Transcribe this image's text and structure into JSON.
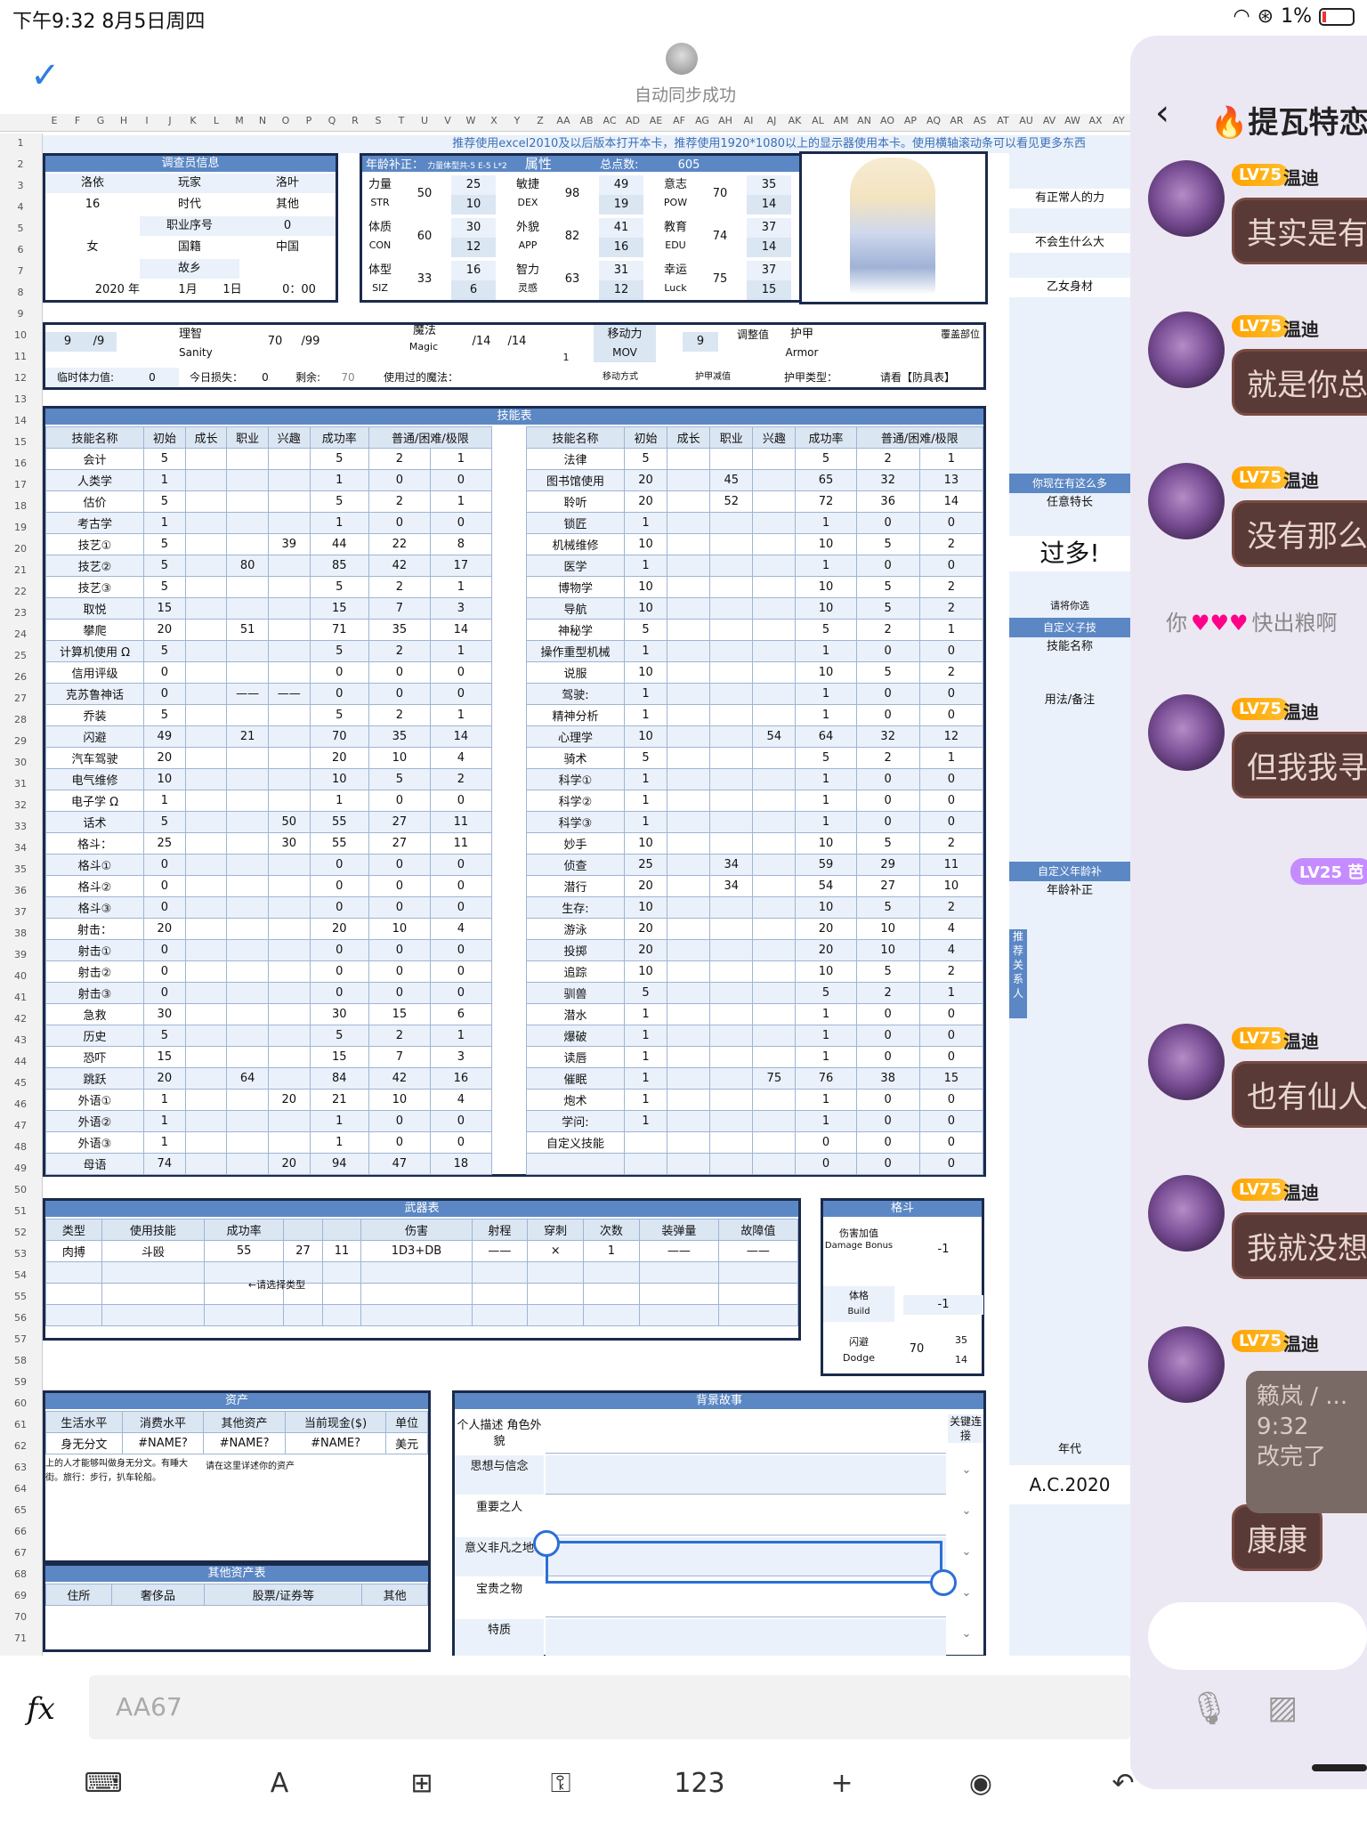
{
  "status": {
    "time": "下午9:32  8月5日周四",
    "battery": "1%"
  },
  "top": {
    "sync": "自动同步成功"
  },
  "column_letters": [
    "E",
    "F",
    "G",
    "H",
    "I",
    "J",
    "K",
    "L",
    "M",
    "N",
    "O",
    "P",
    "Q",
    "R",
    "S",
    "T",
    "U",
    "V",
    "W",
    "X",
    "Y",
    "Z",
    "AA",
    "AB",
    "AC",
    "AD",
    "AE",
    "AF",
    "AG",
    "AH",
    "AI",
    "AJ",
    "AK",
    "AL",
    "AM",
    "AN",
    "AO",
    "AP",
    "AQ",
    "AR",
    "AS",
    "AT",
    "AU",
    "AV",
    "AW",
    "AX",
    "AY"
  ],
  "sheet": {
    "banner": "推荐使用excel2010及以后版本打开本卡，推荐使用1920*1080以上的显示器使用本卡。使用横轴滚动条可以看见更多东西",
    "investigator": {
      "title": "调查员信息",
      "name": "洛依",
      "player_label": "玩家",
      "player": "洛叶",
      "age": "16",
      "era_label": "时代",
      "era": "其他",
      "job_label": "职业序号",
      "job": "0",
      "sex": "女",
      "nation_label": "国籍",
      "nation": "中国",
      "home_label": "故乡",
      "year": "2020 年",
      "month": "1月",
      "day": "1日",
      "clock": "0：00"
    },
    "attr": {
      "age_label": "年龄补正：",
      "age_hint": "力量体型共-5 E-5 L*2",
      "title": "属性",
      "total_label": "总点数:",
      "total": "605",
      "str_cn": "力量",
      "str": "STR",
      "str_v": "50",
      "str_a": "25",
      "str_b": "10",
      "dex_cn": "敏捷",
      "dex": "DEX",
      "dex_v": "98",
      "dex_a": "49",
      "dex_b": "19",
      "pow_cn": "意志",
      "pow": "POW",
      "pow_v": "70",
      "pow_a": "35",
      "pow_b": "14",
      "con_cn": "体质",
      "con": "CON",
      "con_v": "60",
      "con_a": "30",
      "con_b": "12",
      "app_cn": "外貌",
      "app": "APP",
      "app_v": "82",
      "app_a": "41",
      "app_b": "16",
      "edu_cn": "教育",
      "edu": "EDU",
      "edu_v": "74",
      "edu_a": "37",
      "edu_b": "14",
      "siz_cn": "体型",
      "siz": "SIZ",
      "siz_v": "33",
      "siz_a": "16",
      "siz_b": "6",
      "int_cn": "智力",
      "int": "灵感",
      "int_v": "63",
      "int_a": "31",
      "int_b": "12",
      "luck_cn": "幸运",
      "luck": "Luck",
      "luck_v": "75",
      "luck_a": "37",
      "luck_b": "15"
    },
    "status_row": {
      "hp": "9",
      "hp_max": "/9",
      "san_cn": "理智",
      "san": "Sanity",
      "san_v": "70",
      "san_max": "/99",
      "magic_cn": "魔法",
      "magic": "Magic",
      "mp": "/14",
      "mp_max": "/14",
      "mp_regen": "1",
      "move_cn": "移动力",
      "move": "MOV",
      "move_v": "9",
      "adjust": "调整值",
      "armor_cn": "护甲",
      "armor": "Armor",
      "cover": "覆盖部位",
      "temp_hp": "临时体力值:",
      "temp_hp_v": "0",
      "loss": "今日损失：",
      "loss_v": "0",
      "remain": "剩余:",
      "remain_v": "70",
      "spells": "使用过的魔法：",
      "move_mode": "移动方式",
      "armor_red": "护甲减值",
      "armor_type": "护甲类型：",
      "armor_note": "请看【防具表】"
    },
    "skills_title": "技能表",
    "skill_headers": [
      "技能名称",
      "初始",
      "成长",
      "职业",
      "兴趣",
      "成功率",
      "普通/困难/极限"
    ],
    "skills_left": [
      [
        "会计",
        "5",
        "",
        "",
        "",
        "5",
        "2",
        "1"
      ],
      [
        "人类学",
        "1",
        "",
        "",
        "",
        "1",
        "0",
        "0"
      ],
      [
        "估价",
        "5",
        "",
        "",
        "",
        "5",
        "2",
        "1"
      ],
      [
        "考古学",
        "1",
        "",
        "",
        "",
        "1",
        "0",
        "0"
      ],
      [
        "技艺①",
        "5",
        "",
        "",
        "39",
        "44",
        "22",
        "8"
      ],
      [
        "技艺②",
        "5",
        "",
        "80",
        "",
        "85",
        "42",
        "17"
      ],
      [
        "技艺③",
        "5",
        "",
        "",
        "",
        "5",
        "2",
        "1"
      ],
      [
        "取悦",
        "15",
        "",
        "",
        "",
        "15",
        "7",
        "3"
      ],
      [
        "攀爬",
        "20",
        "",
        "51",
        "",
        "71",
        "35",
        "14"
      ],
      [
        "计算机使用 Ω",
        "5",
        "",
        "",
        "",
        "5",
        "2",
        "1"
      ],
      [
        "信用评级",
        "0",
        "",
        "",
        "",
        "0",
        "0",
        "0"
      ],
      [
        "克苏鲁神话",
        "0",
        "",
        "——",
        "——",
        "0",
        "0",
        "0"
      ],
      [
        "乔装",
        "5",
        "",
        "",
        "",
        "5",
        "2",
        "1"
      ],
      [
        "闪避",
        "49",
        "",
        "21",
        "",
        "70",
        "35",
        "14"
      ],
      [
        "汽车驾驶",
        "20",
        "",
        "",
        "",
        "20",
        "10",
        "4"
      ],
      [
        "电气维修",
        "10",
        "",
        "",
        "",
        "10",
        "5",
        "2"
      ],
      [
        "电子学 Ω",
        "1",
        "",
        "",
        "",
        "1",
        "0",
        "0"
      ],
      [
        "话术",
        "5",
        "",
        "",
        "50",
        "55",
        "27",
        "11"
      ],
      [
        "格斗：",
        "25",
        "",
        "",
        "30",
        "55",
        "27",
        "11"
      ],
      [
        "格斗①",
        "0",
        "",
        "",
        "",
        "0",
        "0",
        "0"
      ],
      [
        "格斗②",
        "0",
        "",
        "",
        "",
        "0",
        "0",
        "0"
      ],
      [
        "格斗③",
        "0",
        "",
        "",
        "",
        "0",
        "0",
        "0"
      ],
      [
        "射击：",
        "20",
        "",
        "",
        "",
        "20",
        "10",
        "4"
      ],
      [
        "射击①",
        "0",
        "",
        "",
        "",
        "0",
        "0",
        "0"
      ],
      [
        "射击②",
        "0",
        "",
        "",
        "",
        "0",
        "0",
        "0"
      ],
      [
        "射击③",
        "0",
        "",
        "",
        "",
        "0",
        "0",
        "0"
      ],
      [
        "急救",
        "30",
        "",
        "",
        "",
        "30",
        "15",
        "6"
      ],
      [
        "历史",
        "5",
        "",
        "",
        "",
        "5",
        "2",
        "1"
      ],
      [
        "恐吓",
        "15",
        "",
        "",
        "",
        "15",
        "7",
        "3"
      ],
      [
        "跳跃",
        "20",
        "",
        "64",
        "",
        "84",
        "42",
        "16"
      ],
      [
        "外语①",
        "1",
        "",
        "",
        "20",
        "21",
        "10",
        "4"
      ],
      [
        "外语②",
        "1",
        "",
        "",
        "",
        "1",
        "0",
        "0"
      ],
      [
        "外语③",
        "1",
        "",
        "",
        "",
        "1",
        "0",
        "0"
      ],
      [
        "母语",
        "74",
        "",
        "",
        "20",
        "94",
        "47",
        "18"
      ]
    ],
    "skills_right": [
      [
        "法律",
        "5",
        "",
        "",
        "",
        "5",
        "2",
        "1"
      ],
      [
        "图书馆使用",
        "20",
        "",
        "45",
        "",
        "65",
        "32",
        "13"
      ],
      [
        "聆听",
        "20",
        "",
        "52",
        "",
        "72",
        "36",
        "14"
      ],
      [
        "锁匠",
        "1",
        "",
        "",
        "",
        "1",
        "0",
        "0"
      ],
      [
        "机械维修",
        "10",
        "",
        "",
        "",
        "10",
        "5",
        "2"
      ],
      [
        "医学",
        "1",
        "",
        "",
        "",
        "1",
        "0",
        "0"
      ],
      [
        "博物学",
        "10",
        "",
        "",
        "",
        "10",
        "5",
        "2"
      ],
      [
        "导航",
        "10",
        "",
        "",
        "",
        "10",
        "5",
        "2"
      ],
      [
        "神秘学",
        "5",
        "",
        "",
        "",
        "5",
        "2",
        "1"
      ],
      [
        "操作重型机械",
        "1",
        "",
        "",
        "",
        "1",
        "0",
        "0"
      ],
      [
        "说服",
        "10",
        "",
        "",
        "",
        "10",
        "5",
        "2"
      ],
      [
        "驾驶:",
        "1",
        "",
        "",
        "",
        "1",
        "0",
        "0"
      ],
      [
        "精神分析",
        "1",
        "",
        "",
        "",
        "1",
        "0",
        "0"
      ],
      [
        "心理学",
        "10",
        "",
        "",
        "54",
        "64",
        "32",
        "12"
      ],
      [
        "骑术",
        "5",
        "",
        "",
        "",
        "5",
        "2",
        "1"
      ],
      [
        "科学①",
        "1",
        "",
        "",
        "",
        "1",
        "0",
        "0"
      ],
      [
        "科学②",
        "1",
        "",
        "",
        "",
        "1",
        "0",
        "0"
      ],
      [
        "科学③",
        "1",
        "",
        "",
        "",
        "1",
        "0",
        "0"
      ],
      [
        "妙手",
        "10",
        "",
        "",
        "",
        "10",
        "5",
        "2"
      ],
      [
        "侦查",
        "25",
        "",
        "34",
        "",
        "59",
        "29",
        "11"
      ],
      [
        "潜行",
        "20",
        "",
        "34",
        "",
        "54",
        "27",
        "10"
      ],
      [
        "生存:",
        "10",
        "",
        "",
        "",
        "10",
        "5",
        "2"
      ],
      [
        "游泳",
        "20",
        "",
        "",
        "",
        "20",
        "10",
        "4"
      ],
      [
        "投掷",
        "20",
        "",
        "",
        "",
        "20",
        "10",
        "4"
      ],
      [
        "追踪",
        "10",
        "",
        "",
        "",
        "10",
        "5",
        "2"
      ],
      [
        "驯兽",
        "5",
        "",
        "",
        "",
        "5",
        "2",
        "1"
      ],
      [
        "潜水",
        "1",
        "",
        "",
        "",
        "1",
        "0",
        "0"
      ],
      [
        "爆破",
        "1",
        "",
        "",
        "",
        "1",
        "0",
        "0"
      ],
      [
        "读唇",
        "1",
        "",
        "",
        "",
        "1",
        "0",
        "0"
      ],
      [
        "催眠",
        "1",
        "",
        "",
        "75",
        "76",
        "38",
        "15"
      ],
      [
        "炮术",
        "1",
        "",
        "",
        "",
        "1",
        "0",
        "0"
      ],
      [
        "学问:",
        "1",
        "",
        "",
        "",
        "1",
        "0",
        "0"
      ],
      [
        "自定义技能",
        "",
        "",
        "",
        "",
        "0",
        "0",
        "0"
      ],
      [
        "",
        "",
        "",
        "",
        "",
        "0",
        "0",
        "0"
      ]
    ],
    "weapons": {
      "title": "武器表",
      "headers": [
        "类型",
        "使用技能",
        "成功率",
        "",
        "",
        "伤害",
        "射程",
        "穿刺",
        "次数",
        "装弹量",
        "故障值"
      ],
      "row": [
        "肉搏",
        "斗殴",
        "55",
        "27",
        "11",
        "1D3+DB",
        "——",
        "×",
        "1",
        "——",
        "——"
      ],
      "hint": "←请选择类型"
    },
    "combat": {
      "title": "格斗",
      "db_cn": "伤害加值",
      "db": "Damage Bonus",
      "db_v": "-1",
      "build_cn": "体格",
      "build": "Build",
      "build_v": "-1",
      "dodge_cn": "闪避",
      "dodge": "Dodge",
      "dodge_v": "70",
      "dodge_a": "35",
      "dodge_b": "14"
    },
    "assets": {
      "title": "资产",
      "headers": [
        "生活水平",
        "消费水平",
        "其他资产",
        "当前现金($)",
        "单位"
      ],
      "row": [
        "身无分文",
        "#NAME?",
        "#NAME?",
        "#NAME?",
        "美元"
      ],
      "note": "上的人才能够叫做身无分文。有睡大街。旅行：步行，扒车轮船。",
      "hint": "请在这里详述你的资产"
    },
    "other_assets": {
      "title": "其他资产表",
      "headers": [
        "住所",
        "奢侈品",
        "股票/证券等",
        "其他"
      ]
    },
    "story": {
      "title": "背景故事",
      "link": "关键连接",
      "items": [
        "个人描述 角色外貌",
        "思想与信念",
        "重要之人",
        "意义非凡之地",
        "宝贵之物",
        "特质"
      ]
    },
    "right_panel": {
      "a": "有正常人的力",
      "b": "不会生什么大",
      "c": "乙女身材",
      "d": "你现在有这么多",
      "e": "任意特长",
      "f": "过多!",
      "g": "请将你选",
      "h": "自定义子技",
      "i": "技能名称",
      "j": "用法/备注",
      "k": "自定义年龄补",
      "l": "年龄补正",
      "m": "推荐关系人",
      "n": "年代",
      "o": "A.C.2020"
    }
  },
  "formula_bar": {
    "fx": "fx",
    "cell": "AA67"
  },
  "toolbar": {
    "items": [
      "⌨",
      "A",
      "⊞",
      "⚿",
      "123",
      "+",
      "◉",
      "↶"
    ]
  },
  "chat": {
    "title": "提瓦特恋",
    "messages": [
      {
        "lv": "LV75",
        "name": "温迪",
        "text": "其实是有"
      },
      {
        "lv": "LV75",
        "name": "温迪",
        "text": "就是你总"
      },
      {
        "lv": "LV75",
        "name": "温迪",
        "text": "没有那么"
      },
      {
        "lv": "LV75",
        "name": "温迪",
        "text": "但我我寻人"
      },
      {
        "lv": "LV75",
        "name": "温迪",
        "text": "也有仙人"
      },
      {
        "lv": "LV75",
        "name": "温迪",
        "text": "我就没想"
      },
      {
        "lv": "LV75",
        "name": "温迪",
        "text": "康康"
      }
    ],
    "notice": "你",
    "notice2": "快出粮啊",
    "lv25": "LV25 芭",
    "reply": "籁岚 / ...",
    "reply_time": "9:32",
    "reply_text": "改完了"
  }
}
